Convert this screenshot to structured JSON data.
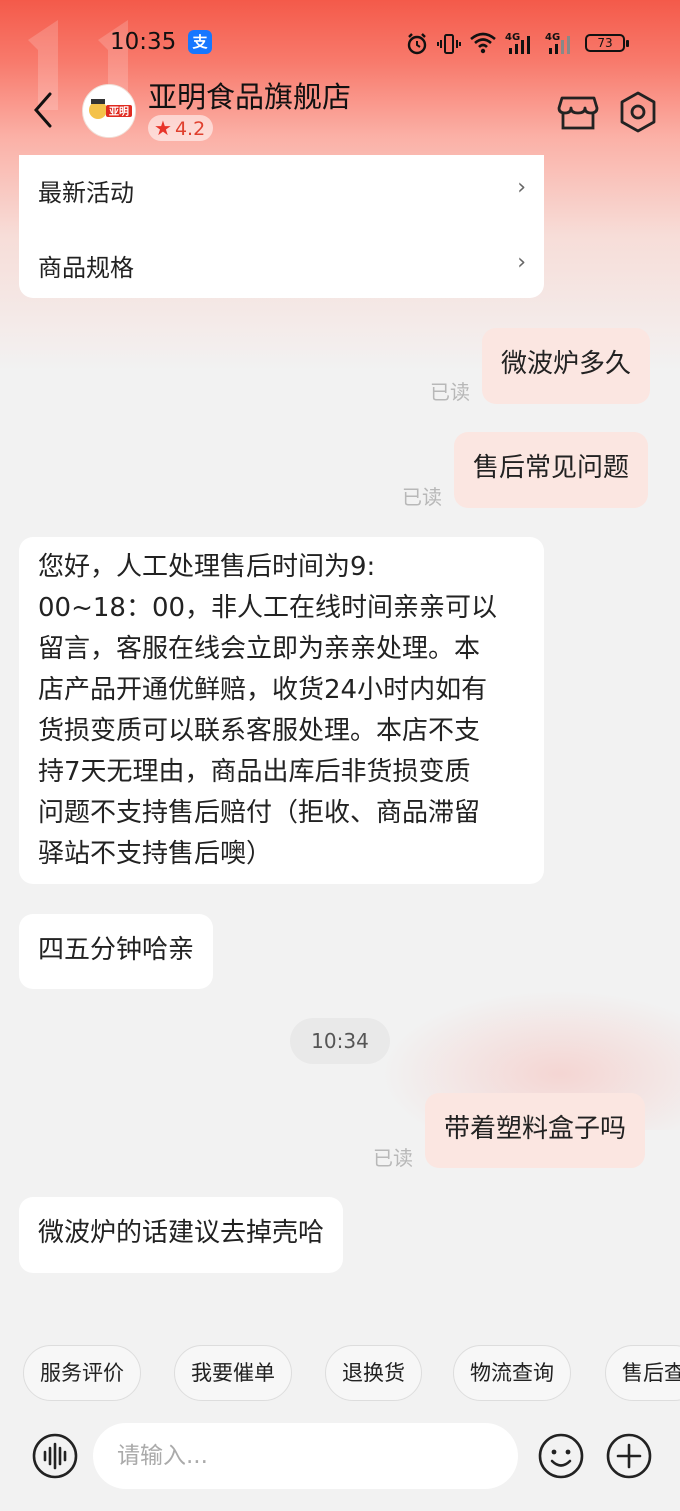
{
  "status_bar": {
    "time": "10:35",
    "alipay_icon": "支",
    "battery": "73"
  },
  "header": {
    "shop_name": "亚明食品旗舰店",
    "rating": "4.2",
    "logo_text": "亚明"
  },
  "menu_card": {
    "items": [
      {
        "label": "最新活动"
      },
      {
        "label": "商品规格"
      }
    ]
  },
  "messages": {
    "m1": {
      "text": "微波炉多久",
      "status": "已读"
    },
    "m2": {
      "text": "售后常见问题",
      "status": "已读"
    },
    "m3": {
      "lines": [
        "您好，人工处理售后时间为9:",
        "00~18：00，非人工在线时间亲亲可以",
        "留言，客服在线会立即为亲亲处理。本",
        "店产品开通优鲜赔，收货24小时内如有",
        "货损变质可以联系客服处理。本店不支",
        "持7天无理由，商品出库后非货损变质",
        "问题不支持售后赔付（拒收、商品滞留",
        "驿站不支持售后噢）"
      ]
    },
    "m4": {
      "text": "四五分钟哈亲"
    },
    "time_divider": "10:34",
    "m5": {
      "text": "带着塑料盒子吗",
      "status": "已读"
    },
    "m6": {
      "text": "微波炉的话建议去掉壳哈"
    }
  },
  "quick_actions": [
    "服务评价",
    "我要催单",
    "退换货",
    "物流查询",
    "售后查"
  ],
  "input": {
    "placeholder": "请输入..."
  },
  "colors": {
    "accent": "#e8342a",
    "user_bubble": "#fbe6e1",
    "header_gradient": "#f45a4a"
  }
}
